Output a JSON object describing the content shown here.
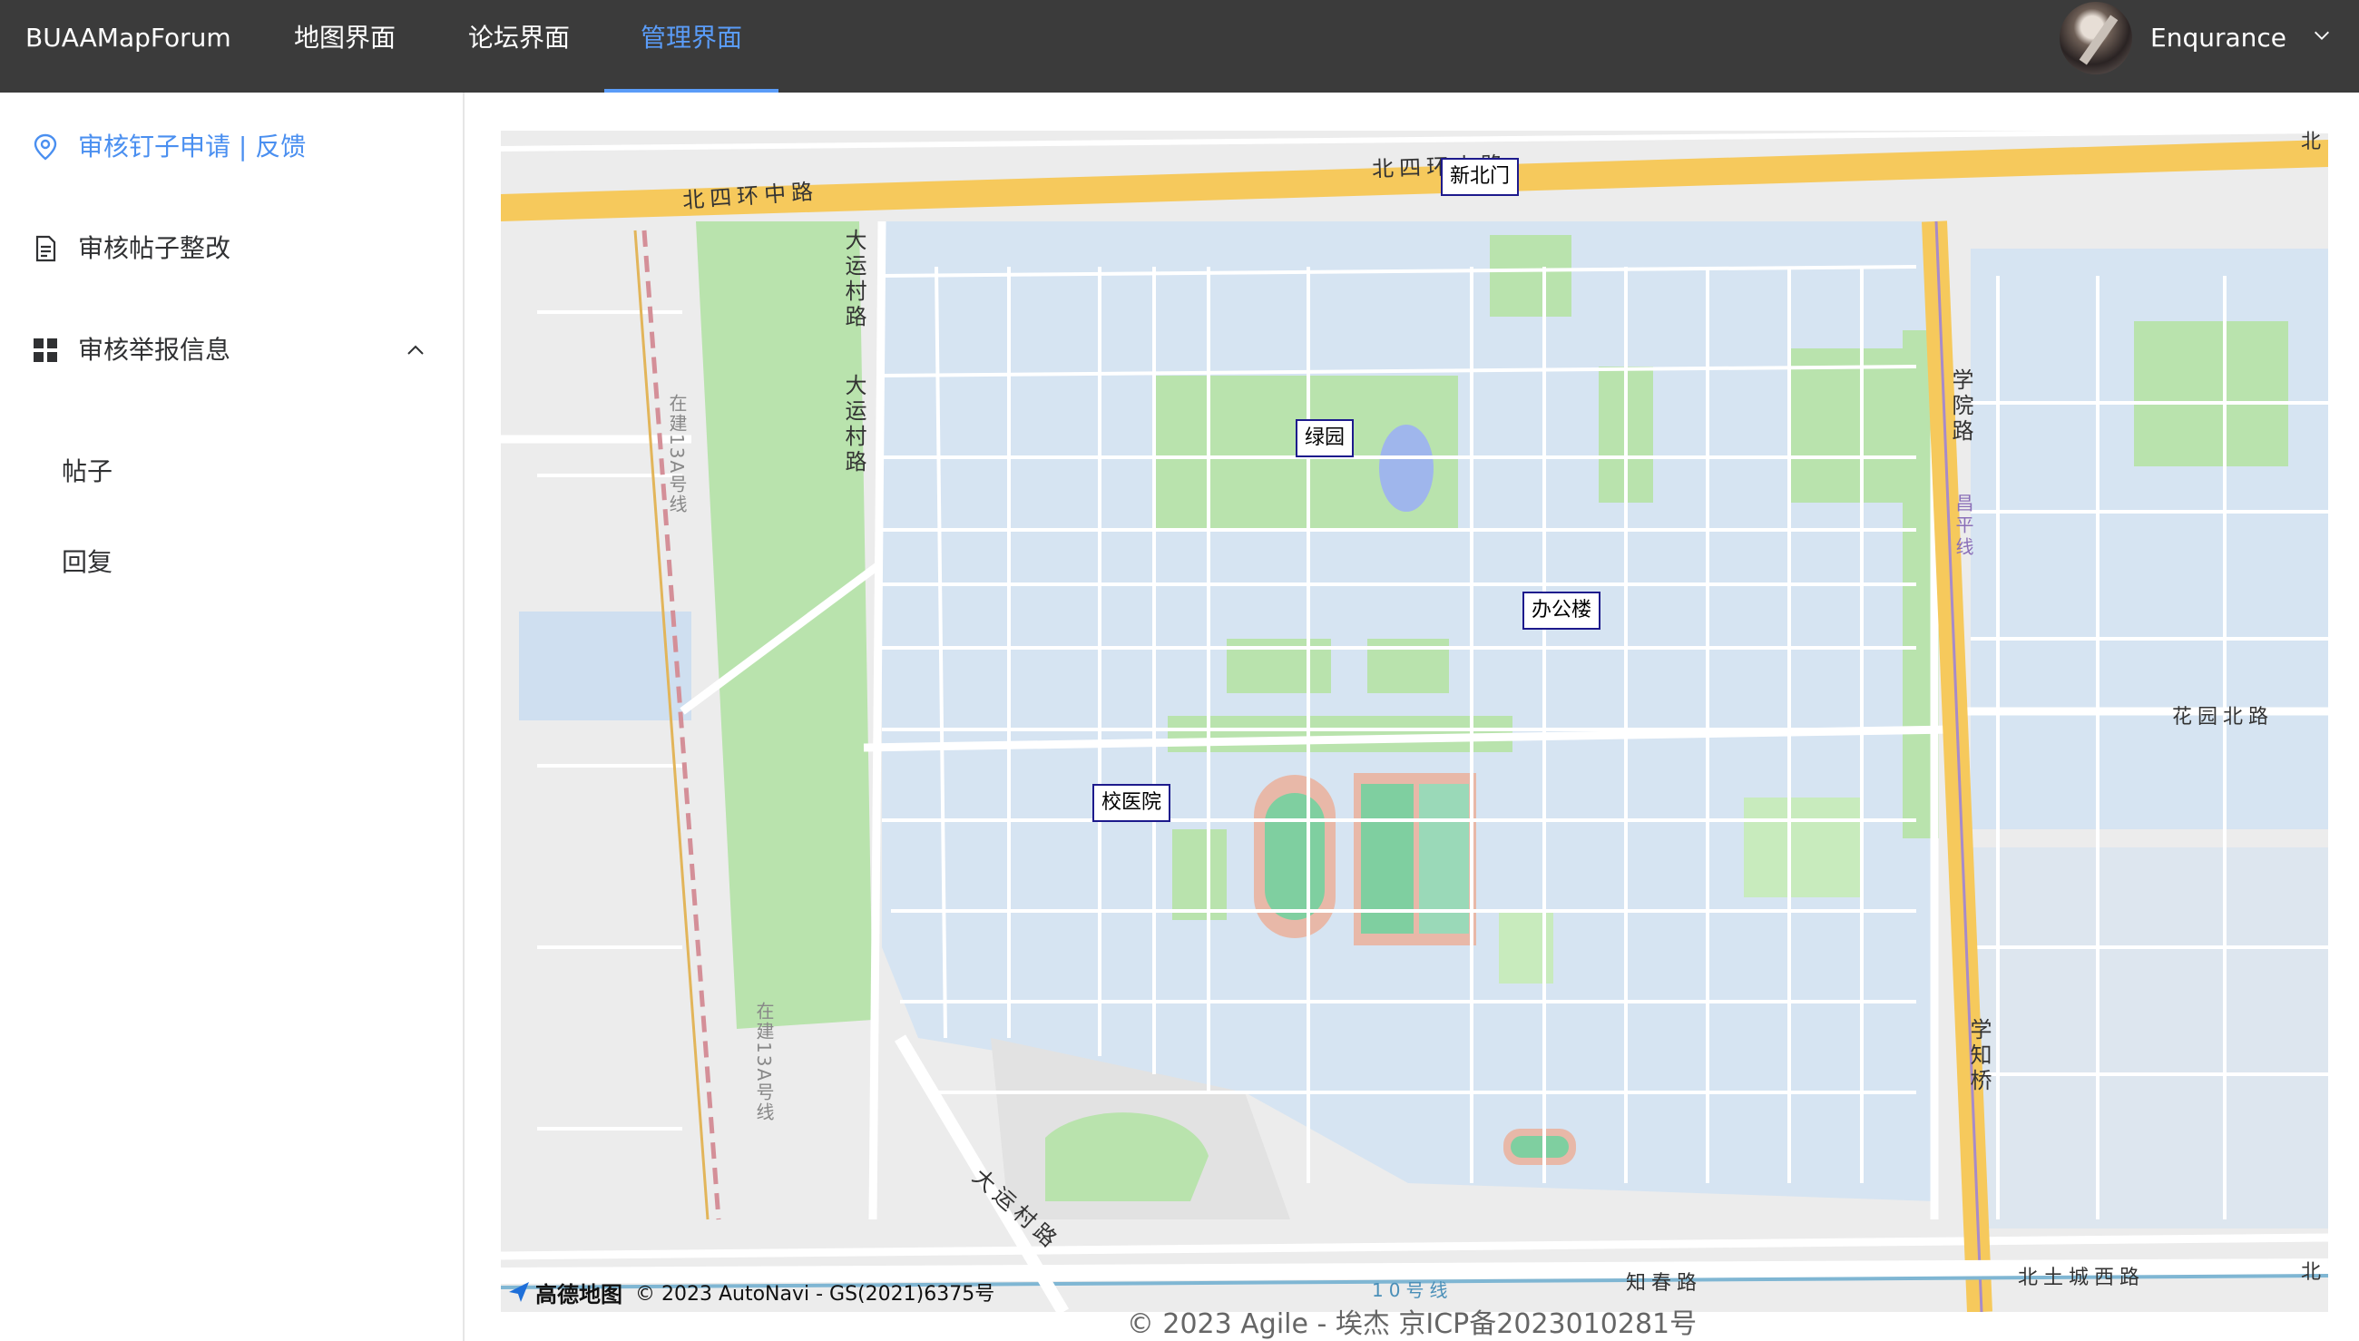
{
  "header": {
    "brand": "BUAAMapForum",
    "tabs": [
      {
        "label": "地图界面"
      },
      {
        "label": "论坛界面"
      },
      {
        "label": "管理界面"
      }
    ],
    "active_tab": "管理界面",
    "username": "Enqurance",
    "accent_color": "#5a9cf8"
  },
  "sidebar": {
    "items": [
      {
        "label": "审核钉子申请 | 反馈",
        "icon": "location-pin-icon"
      },
      {
        "label": "审核帖子整改",
        "icon": "document-icon"
      },
      {
        "label": "审核举报信息",
        "icon": "grid-icon"
      }
    ],
    "subitems": [
      {
        "label": "帖子"
      },
      {
        "label": "回复"
      }
    ]
  },
  "map": {
    "markers": [
      {
        "label": "新北门"
      },
      {
        "label": "绿园"
      },
      {
        "label": "办公楼"
      },
      {
        "label": "校医院"
      }
    ],
    "road_labels": {
      "north_ring_west": "北四环中路",
      "north_ring_east": "北四环中路",
      "dayuncun_1": "大运村路",
      "dayuncun_2": "大运村路",
      "dayuncun_sw": "大运村路",
      "line13_top": "在建13A号线",
      "line13_bottom": "在建13A号线",
      "xueyuan": "学院路",
      "changping": "昌平线",
      "huayuan": "花园北路",
      "xuezhi": "学知桥",
      "zhichun": "知春路",
      "line10": "10号线",
      "beitucheng": "北土城西路",
      "north_edge_top": "北",
      "north_edge_bottom": "北"
    },
    "attribution_logo": "高德地图",
    "attribution_text": "© 2023 AutoNavi - GS(2021)6375号"
  },
  "footer": {
    "text": "© 2023 Agile - 埃杰 京ICP备2023010281号"
  }
}
